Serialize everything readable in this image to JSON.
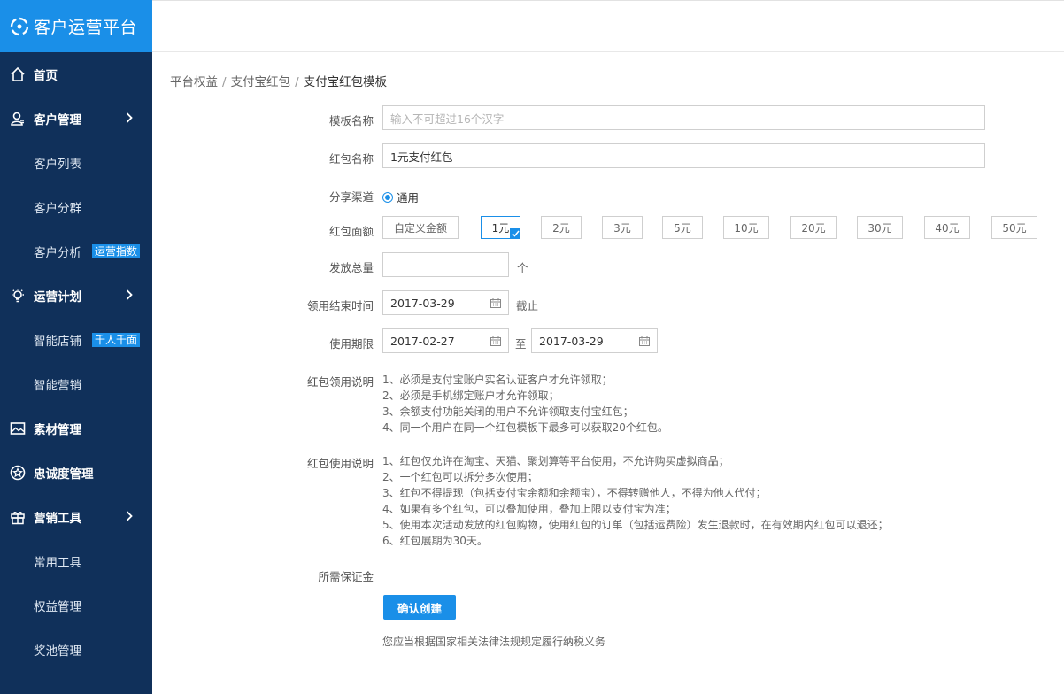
{
  "brand": {
    "title": "客户运营平台"
  },
  "sidebar": {
    "items": [
      {
        "label": "首页",
        "icon": "home-icon",
        "level": "top"
      },
      {
        "label": "客户管理",
        "icon": "user-icon",
        "level": "top",
        "expandable": true
      },
      {
        "label": "客户列表",
        "level": "sub"
      },
      {
        "label": "客户分群",
        "level": "sub"
      },
      {
        "label": "客户分析",
        "level": "sub",
        "tag": "运营指数"
      },
      {
        "label": "运营计划",
        "icon": "lightbulb-icon",
        "level": "top",
        "expandable": true
      },
      {
        "label": "智能店铺",
        "level": "sub",
        "tag": "千人千面"
      },
      {
        "label": "智能营销",
        "level": "sub"
      },
      {
        "label": "素材管理",
        "icon": "image-icon",
        "level": "top"
      },
      {
        "label": "忠诚度管理",
        "icon": "star-badge-icon",
        "level": "top"
      },
      {
        "label": "营销工具",
        "icon": "gift-icon",
        "level": "top",
        "expandable": true
      },
      {
        "label": "常用工具",
        "level": "sub"
      },
      {
        "label": "权益管理",
        "level": "sub"
      },
      {
        "label": "奖池管理",
        "level": "sub"
      }
    ]
  },
  "breadcrumb": [
    "平台权益",
    "支付宝红包",
    "支付宝红包模板"
  ],
  "form": {
    "template_name": {
      "label": "模板名称",
      "value": "",
      "placeholder": "输入不可超过16个汉字"
    },
    "packet_name": {
      "label": "红包名称",
      "value": "1元支付红包"
    },
    "channel": {
      "label": "分享渠道",
      "option": "通用"
    },
    "amount": {
      "label": "红包面额",
      "options": [
        "自定义金额",
        "1元",
        "2元",
        "3元",
        "5元",
        "10元",
        "20元",
        "30元",
        "40元",
        "50元"
      ],
      "selected": "1元"
    },
    "total": {
      "label": "发放总量",
      "value": "",
      "unit": "个"
    },
    "claim_end": {
      "label": "领用结束时间",
      "value": "2017-03-29",
      "suffix": "截止"
    },
    "validity": {
      "label": "使用期限",
      "start": "2017-02-27",
      "to": "至",
      "end": "2017-03-29"
    },
    "claim_notes": {
      "label": "红包领用说明",
      "lines": [
        "1、必须是支付宝账户实名认证客户才允许领取；",
        "2、必须是手机绑定账户才允许领取；",
        "3、余额支付功能关闭的用户不允许领取支付宝红包；",
        "4、同一个用户在同一个红包模板下最多可以获取20个红包。"
      ]
    },
    "use_notes": {
      "label": "红包使用说明",
      "lines": [
        "1、红包仅允许在淘宝、天猫、聚划算等平台使用，不允许购买虚拟商品；",
        "2、一个红包可以拆分多次使用；",
        "3、红包不得提现（包括支付宝余额和余额宝），不得转赠他人，不得为他人代付；",
        "4、如果有多个红包，可以叠加使用，叠加上限以支付宝为准；",
        "5、使用本次活动发放的红包购物，使用红包的订单（包括运费险）发生退款时，在有效期内红包可以退还；",
        "6、红包展期为30天。"
      ]
    },
    "deposit": {
      "label": "所需保证金"
    },
    "submit_label": "确认创建",
    "footnote": "您应当根据国家相关法律法规规定履行纳税义务"
  },
  "colors": {
    "sidebar_bg": "#10305a",
    "accent": "#1a8fe8"
  }
}
